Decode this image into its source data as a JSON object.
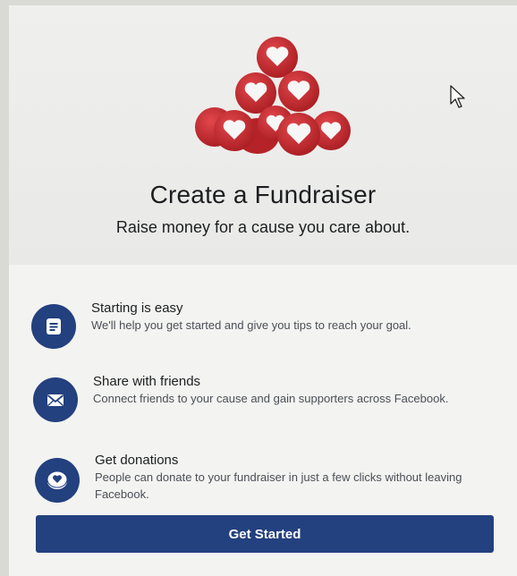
{
  "hero": {
    "title": "Create a Fundraiser",
    "subtitle": "Raise money for a cause you care about."
  },
  "features": [
    {
      "icon": "document-icon",
      "title": "Starting is easy",
      "description": "We'll help you get started and give you tips to reach your goal."
    },
    {
      "icon": "envelope-icon",
      "title": "Share with friends",
      "description": "Connect friends to your cause and gain supporters across Facebook."
    },
    {
      "icon": "heart-coin-icon",
      "title": "Get donations",
      "description": "People can donate to your fundraiser in just a few clicks without leaving Facebook."
    }
  ],
  "cta": {
    "label": "Get Started"
  },
  "colors": {
    "accent": "#23407f",
    "heart_red": "#c62b30"
  }
}
